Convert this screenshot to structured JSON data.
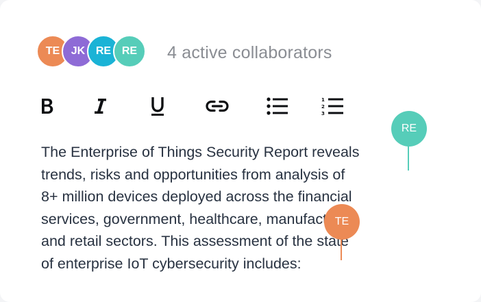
{
  "collaborators": {
    "avatars": [
      {
        "initials": "TE",
        "color": "#ec8a55"
      },
      {
        "initials": "JK",
        "color": "#8e6bd6"
      },
      {
        "initials": "RE",
        "color": "#1ab3d6"
      },
      {
        "initials": "RE",
        "color": "#56cdb9"
      }
    ],
    "summary": "4 active collaborators"
  },
  "toolbar": {
    "tools": [
      {
        "name": "bold",
        "icon": "bold-icon"
      },
      {
        "name": "italic",
        "icon": "italic-icon"
      },
      {
        "name": "underline",
        "icon": "underline-icon"
      },
      {
        "name": "link",
        "icon": "link-icon"
      },
      {
        "name": "bulleted-list",
        "icon": "bulleted-list-icon"
      },
      {
        "name": "numbered-list",
        "icon": "numbered-list-icon"
      }
    ]
  },
  "editor": {
    "text": "The Enterprise of Things Security Report reveals\ntrends, risks and opportunities from analysis of\n8+ million devices deployed across the financial\nservices, government, healthcare, manufacturing\nand retail sectors. This assessment of the state\nof enterprise IoT cybersecurity includes:"
  },
  "cursors": [
    {
      "initials": "RE",
      "color": "#56cdb9"
    },
    {
      "initials": "TE",
      "color": "#ec8a55"
    }
  ]
}
